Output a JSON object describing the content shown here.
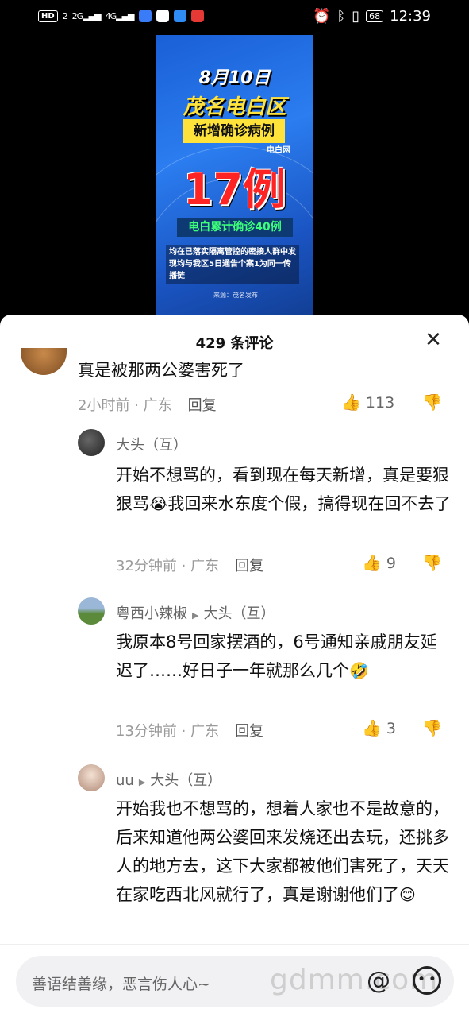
{
  "status_bar": {
    "network_badge": "HD",
    "sim1": "2",
    "sig1": "2G",
    "sig2": "4G",
    "battery": "68",
    "time": "12:39"
  },
  "video": {
    "date": "8月10日",
    "district": "茂名电白区",
    "new_label": "新增确诊病例",
    "source_tag": "电白网",
    "count": "17例",
    "total": "电白累计确诊40例",
    "note": "均在已落实隔离管控的密接人群中发现均与我区5日通告个案1为同一传播链",
    "source": "来源：茂名发布"
  },
  "comments_sheet": {
    "title": "429 条评论",
    "close_icon": "close-icon",
    "comments": [
      {
        "text": "真是被那两公婆害死了",
        "time": "2小时前",
        "location": "广东",
        "reply_label": "回复",
        "likes": "113"
      },
      {
        "author": "大头（互）",
        "text_before": "开始不想骂的，看到现在每天新增，真是要狠狠骂",
        "emoji": "😭",
        "text_after": "我回来水东度个假，搞得现在回不去了",
        "time": "32分钟前",
        "location": "广东",
        "reply_label": "回复",
        "likes": "9"
      },
      {
        "author": "粤西小辣椒",
        "reply_to": "大头（互）",
        "text": "我原本8号回家摆酒的，6号通知亲戚朋友延迟了……好日子一年就那么几个",
        "emoji": "🤣",
        "time": "13分钟前",
        "location": "广东",
        "reply_label": "回复",
        "likes": "3"
      },
      {
        "author": "uu",
        "reply_to": "大头（互）",
        "text": "开始我也不想骂的，想着人家也不是故意的，后来知道他两公婆回来发烧还出去玩，还挑多人的地方去，这下大家都被他们害死了，天天在家吃西北风就行了，真是谢谢他们了",
        "emoji": "😊"
      }
    ]
  },
  "input": {
    "placeholder": "善语结善缘，恶言伤人心~",
    "watermark": "gdmm.com"
  }
}
